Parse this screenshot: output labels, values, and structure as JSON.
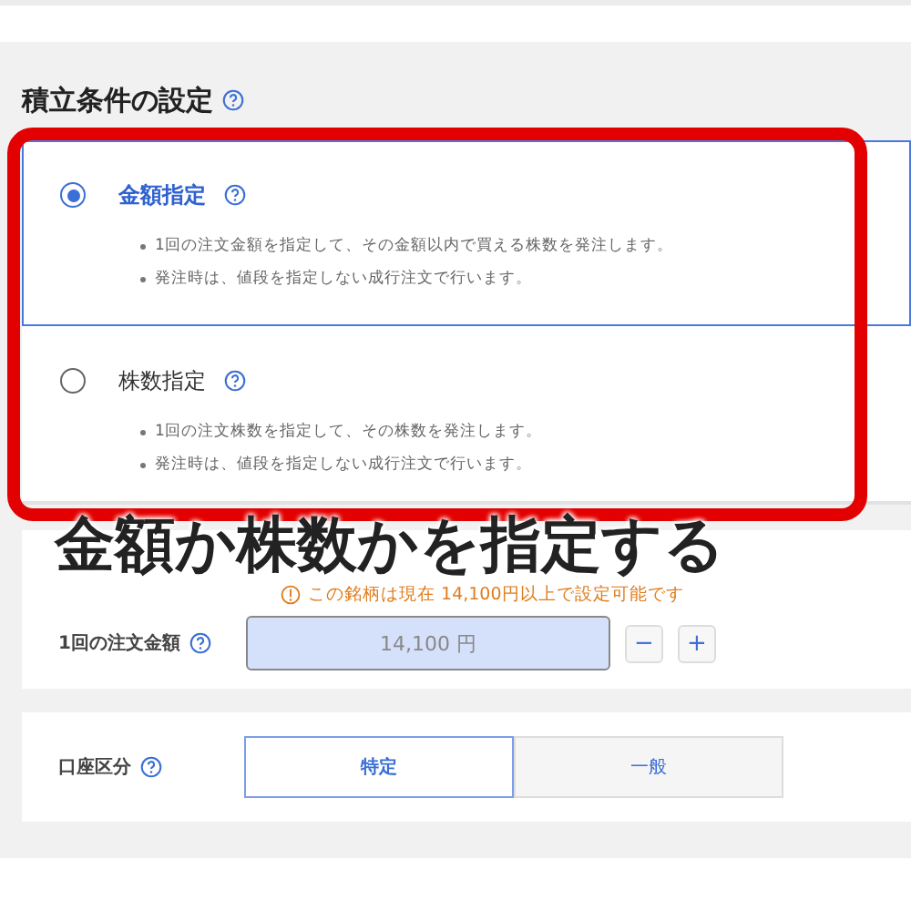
{
  "section": {
    "title": "積立条件の設定"
  },
  "order_types": [
    {
      "label": "金額指定",
      "selected": true,
      "notes": [
        "1回の注文金額を指定して、その金額以内で買える株数を発注します。",
        "発注時は、値段を指定しない成行注文で行います。"
      ]
    },
    {
      "label": "株数指定",
      "selected": false,
      "notes": [
        "1回の注文株数を指定して、その株数を発注します。",
        "発注時は、値段を指定しない成行注文で行います。"
      ]
    }
  ],
  "annotation": {
    "caption": "金額か株数かを指定する"
  },
  "amount": {
    "warning": "この銘柄は現在 14,100円以上で設定可能です",
    "label": "1回の注文金額",
    "value": "14,100 円",
    "minus": "−",
    "plus": "+"
  },
  "account": {
    "label": "口座区分",
    "options": [
      {
        "label": "特定",
        "selected": true
      },
      {
        "label": "一般",
        "selected": false
      }
    ]
  }
}
